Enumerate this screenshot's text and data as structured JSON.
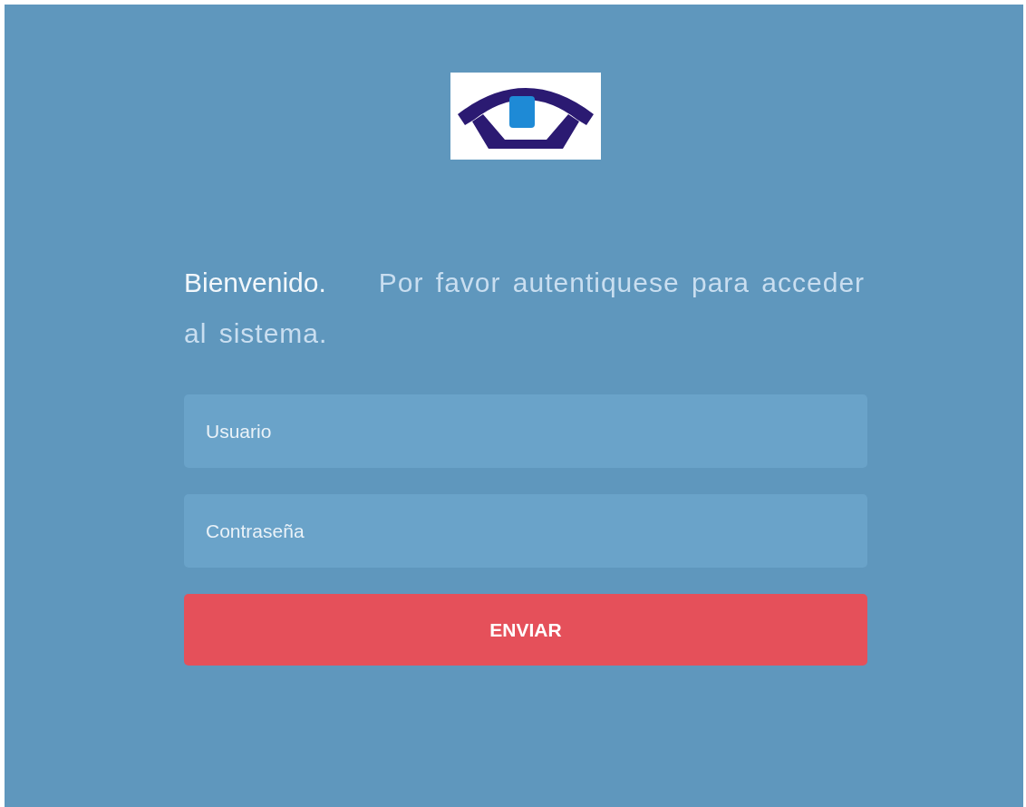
{
  "greeting": "Bienvenido.",
  "message": "Por favor autentiquese para acceder al sistema.",
  "fields": [
    {
      "placeholder": "Usuario"
    },
    {
      "placeholder": "Contraseña"
    }
  ],
  "submit": {
    "label": "ENVIAR"
  }
}
